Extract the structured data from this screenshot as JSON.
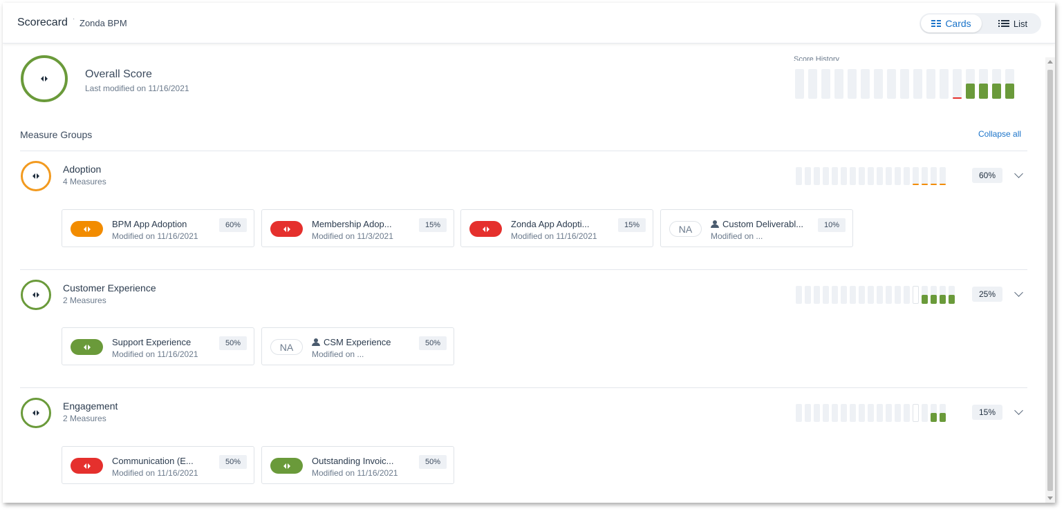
{
  "header": {
    "title": "Scorecard",
    "separator": "·",
    "subtitle": "Zonda BPM",
    "view_toggle": {
      "cards_label": "Cards",
      "list_label": "List",
      "selected": "Cards"
    }
  },
  "overall": {
    "title": "Overall Score",
    "last_modified": "Last modified on 11/16/2021",
    "ring_color": "#6a9a3a",
    "history_label": "Score History",
    "history": [
      "empty",
      "empty",
      "empty",
      "empty",
      "empty",
      "empty",
      "empty",
      "empty",
      "empty",
      "empty",
      "empty",
      "empty",
      "red-line",
      "green",
      "green",
      "green",
      "green"
    ]
  },
  "measure_groups": {
    "title": "Measure Groups",
    "collapse_label": "Collapse all",
    "groups": [
      {
        "name": "Adoption",
        "count": "4 Measures",
        "percent": "60%",
        "ring_color": "#f29a1f",
        "history": [
          "empty",
          "empty",
          "empty",
          "empty",
          "empty",
          "empty",
          "empty",
          "empty",
          "empty",
          "empty",
          "empty",
          "empty",
          "empty",
          "orange-line",
          "orange-line",
          "orange-line",
          "orange-line"
        ],
        "measures": [
          {
            "name": "BPM App Adoption",
            "modified": "Modified on 11/16/2021",
            "weight": "60%",
            "status": "orange",
            "na": false,
            "person": false
          },
          {
            "name": "Membership Adop...",
            "modified": "Modified on 11/3/2021",
            "weight": "15%",
            "status": "red",
            "na": false,
            "person": false
          },
          {
            "name": "Zonda App Adopti...",
            "modified": "Modified on 11/16/2021",
            "weight": "15%",
            "status": "red",
            "na": false,
            "person": false
          },
          {
            "name": "Custom Deliverabl...",
            "modified": "Modified on ...",
            "weight": "10%",
            "status": "na",
            "na": true,
            "na_label": "NA",
            "person": true
          }
        ]
      },
      {
        "name": "Customer Experience",
        "count": "2 Measures",
        "percent": "25%",
        "ring_color": "#6a9a3a",
        "history": [
          "empty",
          "empty",
          "empty",
          "empty",
          "empty",
          "empty",
          "empty",
          "empty",
          "empty",
          "empty",
          "empty",
          "empty",
          "empty",
          "outline",
          "green",
          "green",
          "green",
          "green"
        ],
        "measures": [
          {
            "name": "Support Experience",
            "modified": "Modified on 11/16/2021",
            "weight": "50%",
            "status": "green",
            "na": false,
            "person": false
          },
          {
            "name": "CSM Experience",
            "modified": "Modified on ...",
            "weight": "50%",
            "status": "na",
            "na": true,
            "na_label": "NA",
            "person": true
          }
        ]
      },
      {
        "name": "Engagement",
        "count": "2 Measures",
        "percent": "15%",
        "ring_color": "#6a9a3a",
        "history": [
          "empty",
          "empty",
          "empty",
          "empty",
          "empty",
          "empty",
          "empty",
          "empty",
          "empty",
          "empty",
          "empty",
          "empty",
          "empty",
          "outline",
          "empty",
          "green",
          "green"
        ],
        "measures": [
          {
            "name": "Communication (E...",
            "modified": "Modified on 11/16/2021",
            "weight": "50%",
            "status": "red",
            "na": false,
            "person": false
          },
          {
            "name": "Outstanding Invoic...",
            "modified": "Modified on 11/16/2021",
            "weight": "50%",
            "status": "green",
            "na": false,
            "person": false
          }
        ]
      }
    ]
  },
  "colors": {
    "green": "#6a9a3a",
    "orange": "#f28c00",
    "red": "#e5302d",
    "accent": "#1a73c9"
  }
}
